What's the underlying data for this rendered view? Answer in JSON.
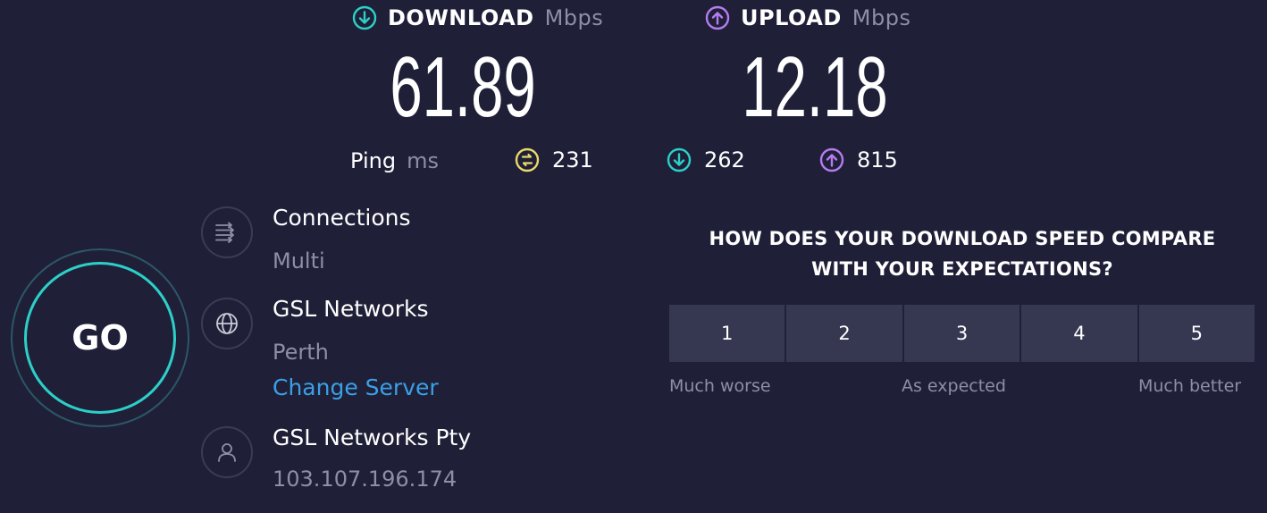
{
  "header": {
    "download": {
      "label": "DOWNLOAD",
      "unit": "Mbps",
      "value": "61.89"
    },
    "upload": {
      "label": "UPLOAD",
      "unit": "Mbps",
      "value": "12.18"
    }
  },
  "ping": {
    "label": "Ping",
    "unit": "ms",
    "idle": "231",
    "download": "262",
    "upload": "815"
  },
  "go_button": {
    "label": "GO"
  },
  "info": {
    "connections": {
      "title": "Connections",
      "value": "Multi"
    },
    "server": {
      "title": "GSL Networks",
      "location": "Perth",
      "change_label": "Change Server"
    },
    "provider": {
      "title": "GSL Networks Pty",
      "ip": "103.107.196.174"
    }
  },
  "survey": {
    "question_line1": "HOW DOES YOUR DOWNLOAD SPEED COMPARE",
    "question_line2": "WITH YOUR EXPECTATIONS?",
    "ratings": [
      "1",
      "2",
      "3",
      "4",
      "5"
    ],
    "scale": {
      "low": "Much worse",
      "mid": "As expected",
      "high": "Much better"
    }
  },
  "colors": {
    "background": "#1f2038",
    "download_accent": "#2cd0c8",
    "upload_accent": "#b57cf0",
    "ping_accent": "#e8d96a",
    "link": "#3aa0e6",
    "muted_text": "#8d8fa6",
    "rating_bg": "#363852"
  },
  "icons": {
    "download": "arrow-down-circle-icon",
    "upload": "arrow-up-circle-icon",
    "ping": "ping-idle-icon",
    "connections": "connections-icon",
    "server": "globe-icon",
    "provider": "user-icon"
  }
}
